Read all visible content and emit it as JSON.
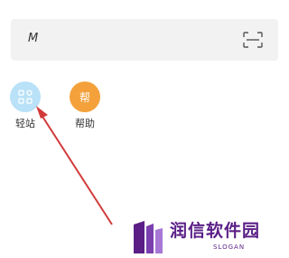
{
  "search": {
    "value": "M",
    "icon": "scan-icon"
  },
  "shortcuts": [
    {
      "label": "轻站",
      "icon": "grid-icon",
      "color": "#b9e1f7"
    },
    {
      "label": "帮助",
      "icon_text": "帮",
      "color": "#f4a13c"
    }
  ],
  "annotation": {
    "arrow_color": "#d23a3a"
  },
  "watermark": {
    "text": "润信软件园",
    "slogan": "SLOGAN",
    "color": "#5a1e86"
  }
}
